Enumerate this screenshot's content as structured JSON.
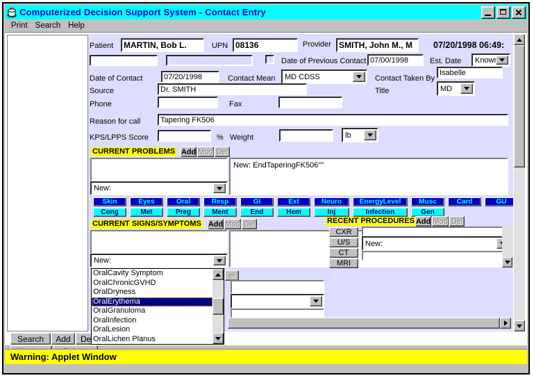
{
  "window": {
    "title": "Computerized Decision Support System - Contact Entry",
    "icon": "app-icon",
    "minimize": "_",
    "maximize": "□",
    "close": "×"
  },
  "menu": [
    "Print",
    "Search",
    "Help"
  ],
  "header": {
    "patient_label": "Patient",
    "patient_value": "MARTIN, Bob L.",
    "upn_label": "UPN",
    "upn_value": "08136",
    "provider_label": "Provider",
    "provider_value": "SMITH, John M., M",
    "datetime_value": "07/20/1998 06:49:",
    "extra_field_1": "",
    "extra_field_2": "",
    "prev_contact_checkbox": "",
    "prev_contact_label": "Date of Previous Contact",
    "prev_contact_value": "07/00/1998",
    "est_date_label": "Est. Date",
    "est_date_value": "Knowr"
  },
  "form": {
    "date_of_contact_label": "Date of Contact",
    "date_of_contact_value": "07/20/1998",
    "contact_mean_label": "Contact Mean",
    "contact_mean_value": "MD CDSS",
    "contact_taken_by_label": "Contact Taken By",
    "contact_taken_by_value": "Isabelle",
    "source_label": "Source",
    "source_value": "Dr. SMITH",
    "title_label": "Title",
    "title_value": "MD",
    "phone_label": "Phone",
    "phone_value": "",
    "fax_label": "Fax",
    "fax_value": "",
    "reason_label": "Reason for call",
    "reason_value": "Tapering FK506",
    "kps_label": "KPS/LPPS Score",
    "kps_value": "",
    "percent_label": "%",
    "weight_label": "Weight",
    "weight_value": "",
    "weight_unit_value": "lb"
  },
  "current_problems": {
    "header": "CURRENT PROBLEMS",
    "add": "Add",
    "mod": "Mod",
    "del": "Del",
    "list_value": "",
    "combo_value": "New:",
    "detail_text": "New: EndTaperingFK506\"\""
  },
  "categories": {
    "row_top": [
      "Skin",
      "Eyes",
      "Oral",
      "Resp",
      "GI",
      "Ext",
      "Neuro",
      "EnergyLevel",
      "Musc",
      "Card",
      "GU"
    ],
    "row_bottom": [
      "Cong",
      "Met",
      "Preg",
      "Ment",
      "End",
      "Hem",
      "Inj",
      "Infection",
      "Gen"
    ]
  },
  "current_signs": {
    "header": "CURRENT SIGNS/SYMPTOMS",
    "add": "Add",
    "mod": "Mod",
    "del": "Del",
    "list_value": "",
    "combo_value": "New:"
  },
  "symptom_list": {
    "items": [
      "OralCavity Symptom",
      "OralChronicGVHD",
      "OralDryness",
      "OralErythema",
      "OralGranuloma",
      "OralInfection",
      "OralLesion",
      "OralLichen Planus"
    ],
    "selected_index": 3
  },
  "hidden_panel": {
    "del_button": "el",
    "field_value": "",
    "combo_value": ""
  },
  "recent_procedures": {
    "header": "RECENT PROCEDURES",
    "add": "Add",
    "mod": "Mod",
    "del": "Del",
    "buttons": [
      "CXR",
      "U/S",
      "CT",
      "MRI"
    ],
    "field_value": "",
    "combo_value": "New:"
  },
  "actions": {
    "search": "Search",
    "add": "Add",
    "del": "Del",
    "update": "Update",
    "submit": "Submit"
  },
  "status": {
    "text": "Warning: Applet Window"
  },
  "colors": {
    "titlebar": "#00ffff",
    "title_text": "#0000cc",
    "form_bg": "#ddddff",
    "accent_blue": "#0000cc",
    "accent_cyan": "#00ffff",
    "highlight_yellow": "#ffff00",
    "selection": "#000080"
  }
}
